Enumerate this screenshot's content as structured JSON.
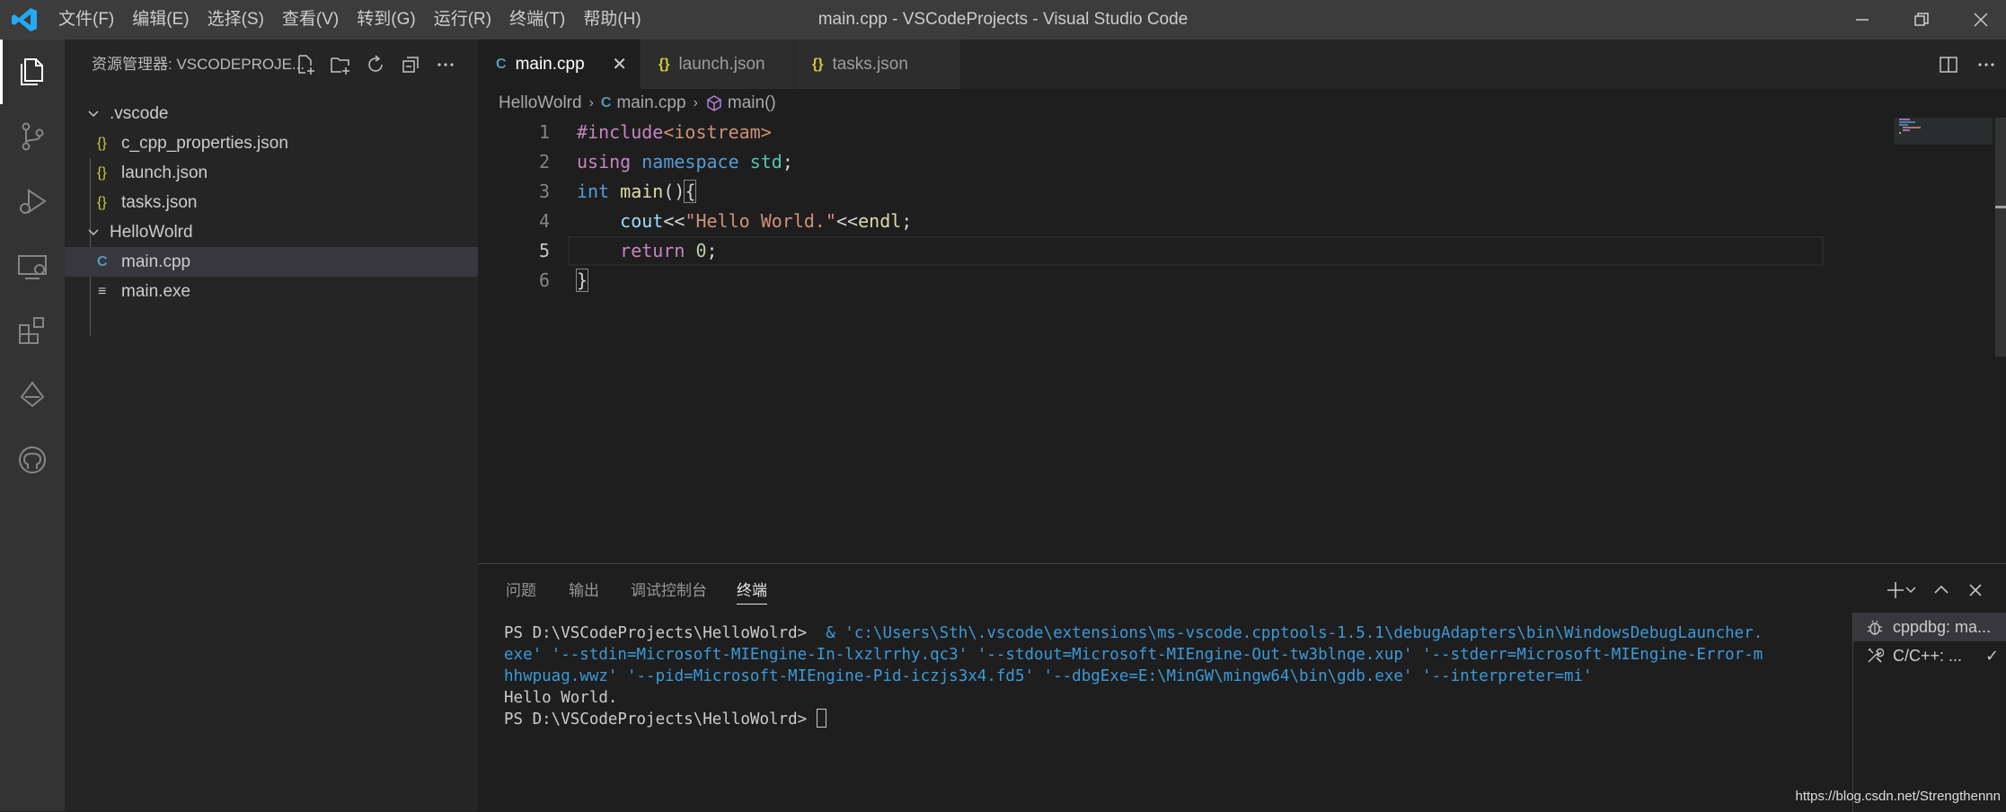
{
  "titlebar": {
    "menus": [
      "文件(F)",
      "编辑(E)",
      "选择(S)",
      "查看(V)",
      "转到(G)",
      "运行(R)",
      "终端(T)",
      "帮助(H)"
    ],
    "title": "main.cpp - VSCodeProjects - Visual Studio Code"
  },
  "activity_bar": {
    "items": [
      "explorer-icon",
      "source-control-icon",
      "run-debug-icon",
      "remote-explorer-icon",
      "extensions-icon",
      "tree-icon",
      "github-icon"
    ]
  },
  "sidebar": {
    "title": "资源管理器: VSCODEPROJE...",
    "tree": [
      {
        "label": ".vscode",
        "type": "folder"
      },
      {
        "label": "c_cpp_properties.json",
        "type": "json",
        "icon": "{}"
      },
      {
        "label": "launch.json",
        "type": "json",
        "icon": "{}"
      },
      {
        "label": "tasks.json",
        "type": "json",
        "icon": "{}"
      },
      {
        "label": "HelloWolrd",
        "type": "folder"
      },
      {
        "label": "main.cpp",
        "type": "cpp",
        "icon": "C",
        "selected": true
      },
      {
        "label": "main.exe",
        "type": "file",
        "icon": "≡"
      }
    ]
  },
  "tabs": [
    {
      "label": "main.cpp",
      "icon": "C",
      "active": true,
      "close": "✕"
    },
    {
      "label": "launch.json",
      "icon": "{}"
    },
    {
      "label": "tasks.json",
      "icon": "{}"
    }
  ],
  "breadcrumb": {
    "folder": "HelloWolrd",
    "file": "main.cpp",
    "symbol": "main()",
    "file_icon": "C",
    "sep": "›"
  },
  "editor": {
    "line_numbers": [
      "1",
      "2",
      "3",
      "4",
      "5",
      "6"
    ],
    "lines": [
      {
        "kw_include": "#include",
        "header": "<iostream>"
      },
      {
        "kw_using": "using",
        "kw_namespace": "namespace",
        "ns": "std",
        "semi": ";"
      },
      {
        "type": "int",
        "fn": "main",
        "paren": "()",
        "brace": "{"
      },
      {
        "indent": "    ",
        "var": "cout",
        "op1": "<<",
        "str": "\"Hello World.\"",
        "op2": "<<",
        "endl": "endl",
        "semi": ";"
      },
      {
        "indent": "    ",
        "kw_return": "return",
        "num": "0",
        "semi": ";"
      },
      {
        "brace": "}"
      }
    ]
  },
  "panel": {
    "tabs": [
      "问题",
      "输出",
      "调试控制台",
      "终端"
    ],
    "active_tab": "终端",
    "terminal": {
      "prompt1": "PS D:\\VSCodeProjects\\HelloWolrd> ",
      "cmd1": " & 'c:\\Users\\Sth\\.vscode\\extensions\\ms-vscode.cpptools-1.5.1\\debugAdapters\\bin\\WindowsDebugLauncher.",
      "cmd2": "exe' '--stdin=Microsoft-MIEngine-In-lxzlrrhy.qc3' '--stdout=Microsoft-MIEngine-Out-tw3blnqe.xup' '--stderr=Microsoft-MIEngine-Error-m",
      "cmd3": "hhwpuag.wwz' '--pid=Microsoft-MIEngine-Pid-iczjs3x4.fd5' '--dbgExe=E:\\MinGW\\mingw64\\bin\\gdb.exe' '--interpreter=mi'",
      "output": "Hello World.",
      "prompt2": "PS D:\\VSCodeProjects\\HelloWolrd> "
    },
    "terminal_list": [
      {
        "label": "cppdbg: ma...",
        "selected": true
      },
      {
        "label": "C/C++: ...",
        "check": "✓"
      }
    ]
  },
  "watermark": "https://blog.csdn.net/Strengthennn",
  "colors": {
    "accent": "#007acc",
    "titlebar": "#3c3c3c",
    "activitybar": "#333333",
    "sidebar": "#252526",
    "editor": "#1e1e1e"
  }
}
